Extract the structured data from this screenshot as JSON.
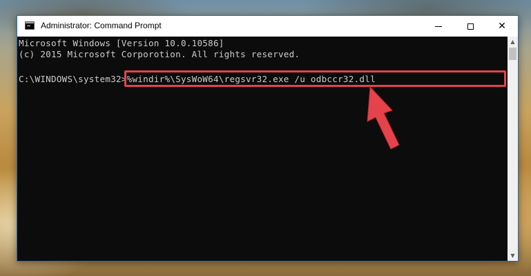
{
  "window": {
    "title": "Administrator: Command Prompt",
    "controls": {
      "minimize": "",
      "maximize": "",
      "close": "✕"
    }
  },
  "console": {
    "lines": [
      "Microsoft Windows [Version 10.0.10586]",
      "(c) 2015 Microsoft Corporotion. All rights reserved.",
      "",
      "C:\\WINDOWS\\system32>%windir%\\SysWoW64\\regsvr32.exe /u odbccr32.dll"
    ]
  },
  "colors": {
    "console_bg": "#0c0c0c",
    "console_text": "#cccccc",
    "highlight_box": "#e5434b",
    "arrow": "#e5434b"
  },
  "icons": {
    "app": "cmd-app-icon",
    "annotation": "red-arrow-icon"
  }
}
